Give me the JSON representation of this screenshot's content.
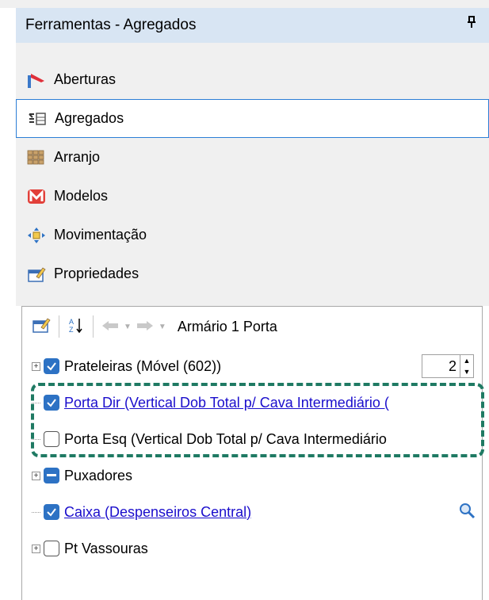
{
  "panel": {
    "title": "Ferramentas - Agregados",
    "pin_icon": "pin-icon"
  },
  "categories": [
    {
      "label": "Aberturas",
      "icon": "flag-icon"
    },
    {
      "label": "Agregados",
      "icon": "aggregate-icon",
      "selected": true
    },
    {
      "label": "Arranjo",
      "icon": "grid-icon"
    },
    {
      "label": "Modelos",
      "icon": "m-logo-icon"
    },
    {
      "label": "Movimentação",
      "icon": "move-arrows-icon"
    },
    {
      "label": "Propriedades",
      "icon": "properties-icon"
    }
  ],
  "toolbar": {
    "title": "Armário 1 Porta"
  },
  "tree": {
    "items": [
      {
        "label": "Prateleiras (Móvel (602))",
        "state": "checked",
        "expandable": true,
        "spinner_value": "2"
      },
      {
        "label": "Porta Dir (Vertical Dob Total p/ Cava Intermediário (",
        "state": "checked",
        "link": true
      },
      {
        "label": "Porta Esq (Vertical Dob Total p/ Cava Intermediário",
        "state": "unchecked"
      },
      {
        "label": "Puxadores",
        "state": "indeterminate",
        "expandable": true
      },
      {
        "label": "Caixa (Despenseiros Central)",
        "state": "checked",
        "link": true,
        "icon": "magnifier-icon"
      },
      {
        "label": "Pt Vassouras",
        "state": "unchecked",
        "expandable": true
      }
    ]
  },
  "colors": {
    "accent": "#2d72c4",
    "header_bg": "#d8e5f3",
    "highlight_dash": "#1f7a63",
    "link": "#1a0dcc"
  }
}
